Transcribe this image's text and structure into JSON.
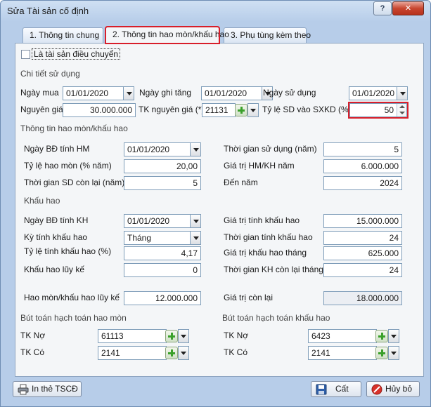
{
  "window": {
    "title": "Sửa Tài sản cố định",
    "help_label": "?",
    "close_label": "✕"
  },
  "tabs": [
    {
      "label": "1. Thông tin chung"
    },
    {
      "label": "2. Thông tin hao mòn/khấu hao"
    },
    {
      "label": "3. Phụ tùng kèm theo"
    }
  ],
  "transfer_checkbox": {
    "label": "Là tài sản điều chuyển",
    "checked": false
  },
  "usage": {
    "section": "Chi tiết sử dụng",
    "purchase_date_label": "Ngày mua",
    "purchase_date": "01/01/2020",
    "increase_date_label": "Ngày ghi tăng",
    "increase_date": "01/01/2020",
    "use_date_label": "Ngày sử dụng",
    "use_date": "01/01/2020",
    "cost_label": "Nguyên giá",
    "cost": "30.000.000",
    "cost_account_label": "TK nguyên giá (*)",
    "cost_account": "21131",
    "ratio_label": "Tỷ lệ SD vào SXKD (%)",
    "ratio": "50"
  },
  "depreciation": {
    "section": "Thông tin hao mòn/khấu hao",
    "start_date_label": "Ngày BĐ tính HM",
    "start_date": "01/01/2020",
    "rate_label": "Tỷ lệ hao mòn (% năm)",
    "rate": "20,00",
    "remaining_label": "Thời gian SD còn lại (năm)",
    "remaining": "5",
    "use_years_label": "Thời gian sử dụng (năm)",
    "use_years": "5",
    "annual_value_label": "Giá trị HM/KH năm",
    "annual_value": "6.000.000",
    "end_year_label": "Đến năm",
    "end_year": "2024"
  },
  "amortization": {
    "section": "Khấu hao",
    "start_date_label": "Ngày BĐ tính KH",
    "start_date": "01/01/2020",
    "period_label": "Kỳ tính khấu hao",
    "period": "Tháng",
    "rate_label": "Tỷ lệ tính khấu hao (%)",
    "rate": "4,17",
    "accumulated_label": "Khấu hao lũy kế",
    "accumulated": "0",
    "base_value_label": "Giá trị tính khấu hao",
    "base_value": "15.000.000",
    "months_label": "Thời gian tính khấu hao",
    "months": "24",
    "monthly_value_label": "Giá trị khấu hao tháng",
    "monthly_value": "625.000",
    "remaining_months_label": "Thời gian KH còn lại tháng",
    "remaining_months": "24"
  },
  "totals": {
    "accumulated_label": "Hao mòn/khấu hao lũy kế",
    "accumulated": "12.000.000",
    "residual_label": "Giá trị còn lại",
    "residual": "18.000.000"
  },
  "wear_entry": {
    "section": "Bút toán hạch toán hao mòn",
    "debit_label": "TK Nợ",
    "debit": "61113",
    "credit_label": "TK Có",
    "credit": "2141"
  },
  "amort_entry": {
    "section": "Bút toán hạch toán khấu hao",
    "debit_label": "TK Nợ",
    "debit": "6423",
    "credit_label": "TK Có",
    "credit": "2141"
  },
  "buttons": {
    "print": "In thẻ TSCĐ",
    "save": "Cất",
    "cancel": "Hủy bỏ"
  },
  "colors": {
    "highlight": "#d81e2a",
    "add_icon": "#3aa02a"
  }
}
